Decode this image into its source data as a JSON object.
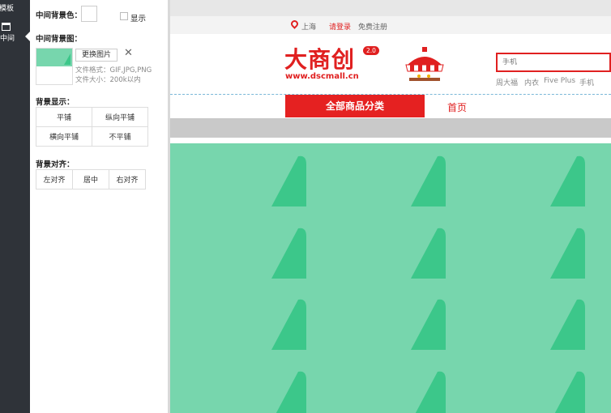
{
  "rail": {
    "template_label": "模板",
    "middle_label": "中间"
  },
  "panel": {
    "bg_color_label": "中间背景色：",
    "show_label": "显示",
    "bg_image_label": "中间背景图：",
    "replace_button": "更换图片",
    "close_glyph": "✕",
    "file_format_hint": "文件格式：GIF,JPG,PNG",
    "file_size_hint": "文件大小：200k以内",
    "bg_display_label": "背景显示：",
    "display_options": [
      "平铺",
      "纵向平铺",
      "横向平铺",
      "不平铺"
    ],
    "bg_align_label": "背景对齐：",
    "align_options": [
      "左对齐",
      "居中",
      "右对齐"
    ]
  },
  "preview": {
    "location": "上海",
    "login": "请登录",
    "register": "免费注册",
    "logo_text": "大商创",
    "logo_version": "2.0",
    "logo_url": "www.dscmall.cn",
    "search_placeholder": "手机",
    "hot_words": [
      "周大福",
      "内衣",
      "Five Plus",
      "手机"
    ],
    "nav_all_categories": "全部商品分类",
    "nav_home": "首页"
  },
  "colors": {
    "accent": "#e02020",
    "pattern_bg": "#77d6ad",
    "pattern_fg": "#3cc78a",
    "rail": "#2f3339"
  }
}
